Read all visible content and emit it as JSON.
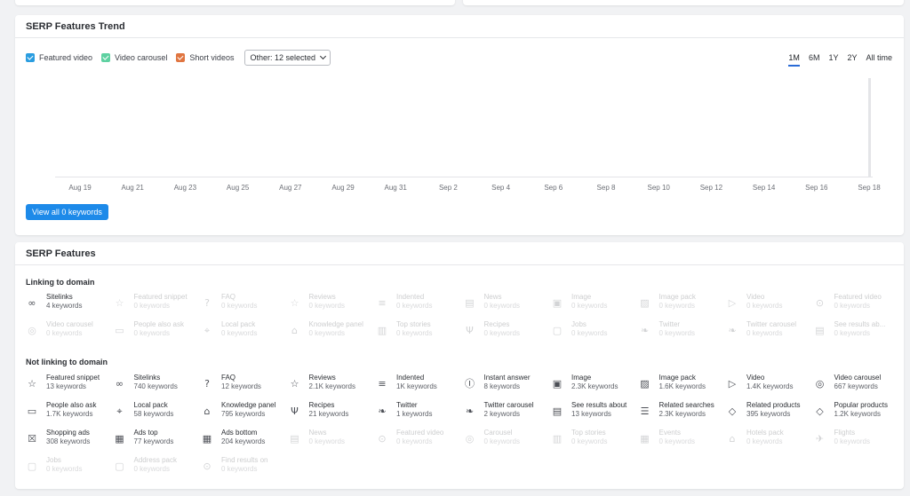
{
  "trend": {
    "title": "SERP Features Trend",
    "legend": [
      {
        "label": "Featured video",
        "color": "#2a9de0"
      },
      {
        "label": "Video carousel",
        "color": "#5ed1a1"
      },
      {
        "label": "Short videos",
        "color": "#e07540"
      }
    ],
    "other_select": "Other: 12 selected",
    "ranges": [
      "1M",
      "6M",
      "1Y",
      "2Y",
      "All time"
    ],
    "active_range": "1M",
    "view_button": "View all 0 keywords"
  },
  "chart_data": {
    "type": "bar",
    "categories": [
      "Aug 19",
      "Aug 21",
      "Aug 23",
      "Aug 25",
      "Aug 27",
      "Aug 29",
      "Aug 31",
      "Sep 2",
      "Sep 4",
      "Sep 6",
      "Sep 8",
      "Sep 10",
      "Sep 12",
      "Sep 14",
      "Sep 16",
      "Sep 18"
    ],
    "series": [],
    "title": "SERP Features Trend",
    "xlabel": "",
    "ylabel": ""
  },
  "features": {
    "title": "SERP Features",
    "linking": {
      "label": "Linking to domain",
      "items": [
        {
          "name": "Sitelinks",
          "count": "4 keywords",
          "icon": "link-icon",
          "active": true
        },
        {
          "name": "Featured snippet",
          "count": "0 keywords",
          "icon": "star-icon",
          "active": false
        },
        {
          "name": "FAQ",
          "count": "0 keywords",
          "icon": "question-icon",
          "active": false
        },
        {
          "name": "Reviews",
          "count": "0 keywords",
          "icon": "star-icon",
          "active": false
        },
        {
          "name": "Indented",
          "count": "0 keywords",
          "icon": "indented-icon",
          "active": false
        },
        {
          "name": "News",
          "count": "0 keywords",
          "icon": "news-icon",
          "active": false
        },
        {
          "name": "Image",
          "count": "0 keywords",
          "icon": "image-icon",
          "active": false
        },
        {
          "name": "Image pack",
          "count": "0 keywords",
          "icon": "image-pack-icon",
          "active": false
        },
        {
          "name": "Video",
          "count": "0 keywords",
          "icon": "video-icon",
          "active": false
        },
        {
          "name": "Featured video",
          "count": "0 keywords",
          "icon": "play-circle-icon",
          "active": false
        },
        {
          "name": "Video carousel",
          "count": "0 keywords",
          "icon": "carousel-icon",
          "active": false
        },
        {
          "name": "People also ask",
          "count": "0 keywords",
          "icon": "chat-icon",
          "active": false
        },
        {
          "name": "Local pack",
          "count": "0 keywords",
          "icon": "pin-icon",
          "active": false
        },
        {
          "name": "Knowledge panel",
          "count": "0 keywords",
          "icon": "graduation-icon",
          "active": false
        },
        {
          "name": "Top stories",
          "count": "0 keywords",
          "icon": "stories-icon",
          "active": false
        },
        {
          "name": "Recipes",
          "count": "0 keywords",
          "icon": "fork-knife-icon",
          "active": false
        },
        {
          "name": "Jobs",
          "count": "0 keywords",
          "icon": "briefcase-icon",
          "active": false
        },
        {
          "name": "Twitter",
          "count": "0 keywords",
          "icon": "twitter-icon",
          "active": false
        },
        {
          "name": "Twitter carousel",
          "count": "0 keywords",
          "icon": "twitter-icon",
          "active": false
        },
        {
          "name": "See results ab...",
          "count": "0 keywords",
          "icon": "results-icon",
          "active": false
        }
      ]
    },
    "not_linking": {
      "label": "Not linking to domain",
      "items": [
        {
          "name": "Featured snippet",
          "count": "13 keywords",
          "icon": "star-icon",
          "active": true
        },
        {
          "name": "Sitelinks",
          "count": "740 keywords",
          "icon": "link-icon",
          "active": true
        },
        {
          "name": "FAQ",
          "count": "12 keywords",
          "icon": "question-icon",
          "active": true
        },
        {
          "name": "Reviews",
          "count": "2.1K keywords",
          "icon": "star-icon",
          "active": true
        },
        {
          "name": "Indented",
          "count": "1K keywords",
          "icon": "indented-icon",
          "active": true
        },
        {
          "name": "Instant answer",
          "count": "8 keywords",
          "icon": "help-circle-icon",
          "active": true
        },
        {
          "name": "Image",
          "count": "2.3K keywords",
          "icon": "image-icon",
          "active": true
        },
        {
          "name": "Image pack",
          "count": "1.6K keywords",
          "icon": "image-pack-icon",
          "active": true
        },
        {
          "name": "Video",
          "count": "1.4K keywords",
          "icon": "video-icon",
          "active": true
        },
        {
          "name": "Video carousel",
          "count": "667 keywords",
          "icon": "carousel-icon",
          "active": true
        },
        {
          "name": "People also ask",
          "count": "1.7K keywords",
          "icon": "chat-icon",
          "active": true
        },
        {
          "name": "Local pack",
          "count": "58 keywords",
          "icon": "pin-icon",
          "active": true
        },
        {
          "name": "Knowledge panel",
          "count": "795 keywords",
          "icon": "graduation-icon",
          "active": true
        },
        {
          "name": "Recipes",
          "count": "21 keywords",
          "icon": "fork-knife-icon",
          "active": true
        },
        {
          "name": "Twitter",
          "count": "1 keywords",
          "icon": "twitter-icon",
          "active": true
        },
        {
          "name": "Twitter carousel",
          "count": "2 keywords",
          "icon": "twitter-icon",
          "active": true
        },
        {
          "name": "See results about",
          "count": "13 keywords",
          "icon": "results-icon",
          "active": true
        },
        {
          "name": "Related searches",
          "count": "2.3K keywords",
          "icon": "list-icon",
          "active": true
        },
        {
          "name": "Related products",
          "count": "395 keywords",
          "icon": "tag-icon",
          "active": true
        },
        {
          "name": "Popular products",
          "count": "1.2K keywords",
          "icon": "tag-icon",
          "active": true
        },
        {
          "name": "Shopping ads",
          "count": "308 keywords",
          "icon": "cart-icon",
          "active": true
        },
        {
          "name": "Ads top",
          "count": "77 keywords",
          "icon": "ad-icon",
          "active": true
        },
        {
          "name": "Ads bottom",
          "count": "204 keywords",
          "icon": "ad-icon",
          "active": true
        },
        {
          "name": "News",
          "count": "0 keywords",
          "icon": "news-icon",
          "active": false
        },
        {
          "name": "Featured video",
          "count": "0 keywords",
          "icon": "play-circle-icon",
          "active": false
        },
        {
          "name": "Carousel",
          "count": "0 keywords",
          "icon": "carousel-icon",
          "active": false
        },
        {
          "name": "Top stories",
          "count": "0 keywords",
          "icon": "stories-icon",
          "active": false
        },
        {
          "name": "Events",
          "count": "0 keywords",
          "icon": "calendar-icon",
          "active": false
        },
        {
          "name": "Hotels pack",
          "count": "0 keywords",
          "icon": "hotel-icon",
          "active": false
        },
        {
          "name": "Flights",
          "count": "0 keywords",
          "icon": "plane-icon",
          "active": false
        },
        {
          "name": "Jobs",
          "count": "0 keywords",
          "icon": "briefcase-icon",
          "active": false
        },
        {
          "name": "Address pack",
          "count": "0 keywords",
          "icon": "address-icon",
          "active": false
        },
        {
          "name": "Find results on",
          "count": "0 keywords",
          "icon": "find-icon",
          "active": false
        }
      ]
    }
  }
}
